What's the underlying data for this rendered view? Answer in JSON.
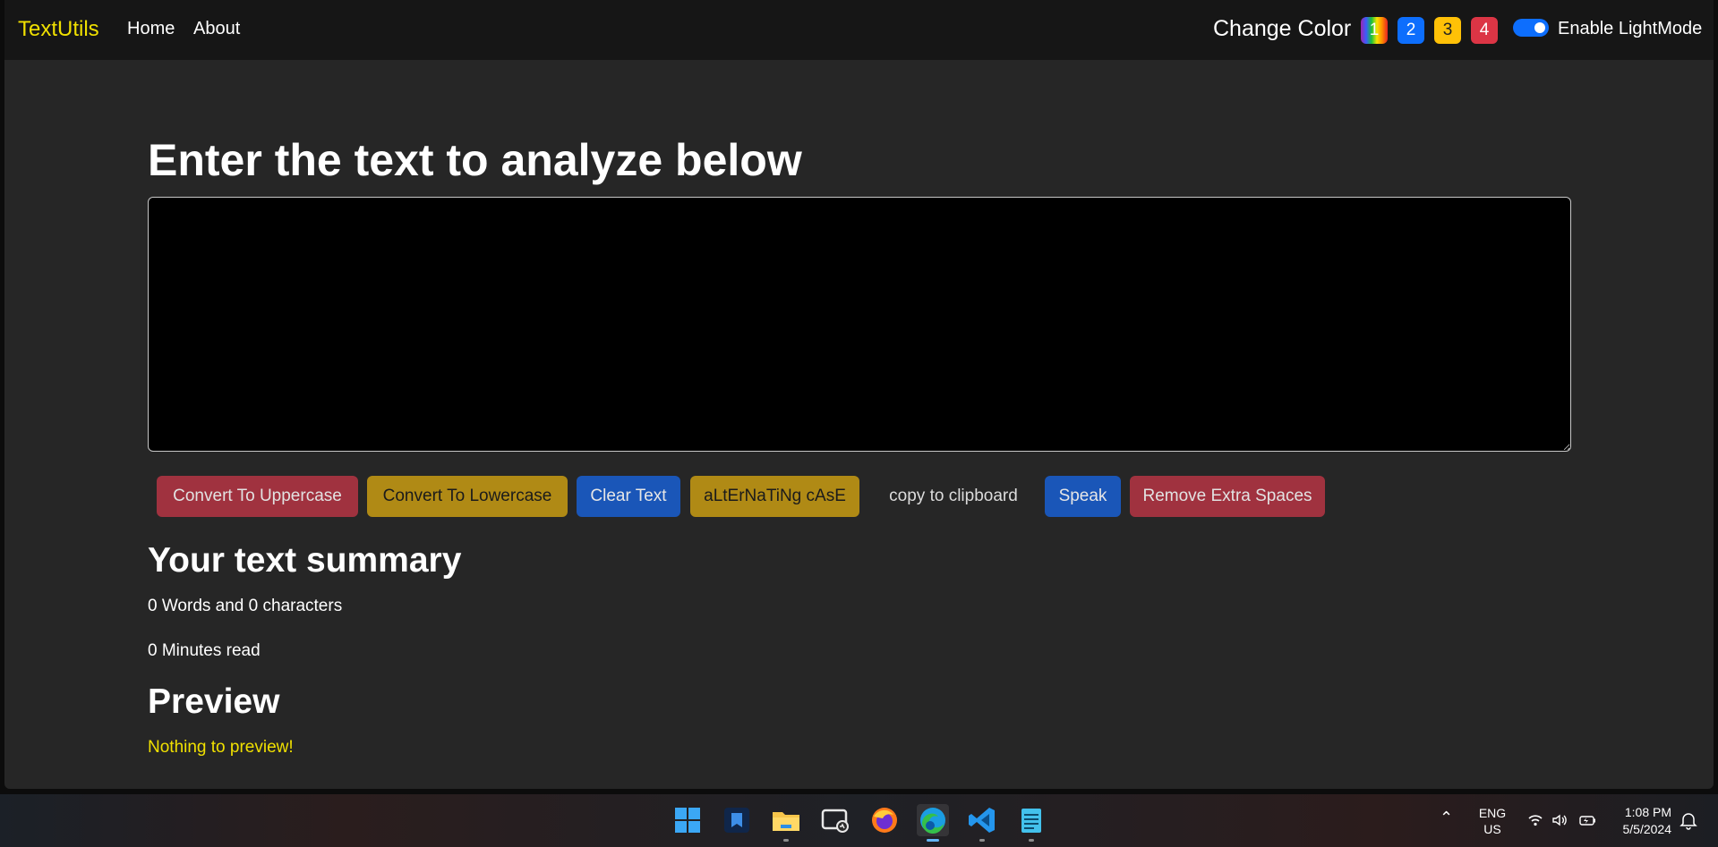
{
  "navbar": {
    "brand": "TextUtils",
    "links": [
      "Home",
      "About"
    ],
    "change_color_label": "Change Color",
    "swatches": [
      "1",
      "2",
      "3",
      "4"
    ],
    "swatch_colors": [
      "rainbow",
      "#0d6efd",
      "#ffc107",
      "#dc3545"
    ],
    "toggle_label": "Enable LightMode",
    "toggle_on": true,
    "brand_color": "#f0e000"
  },
  "main": {
    "heading": "Enter the text to analyze below",
    "textarea_value": "",
    "buttons": [
      "Convert To Uppercase",
      "Convert To Lowercase",
      "Clear Text",
      "aLtErNaTiNg cAsE",
      "copy to clipboard",
      "Speak",
      "Remove Extra Spaces"
    ],
    "summary_title": "Your text summary",
    "summary_words": "0 Words and 0 characters",
    "summary_read": "0 Minutes read",
    "preview_title": "Preview",
    "preview_text": "Nothing to preview!"
  },
  "taskbar": {
    "icons": [
      "windows-start-icon",
      "app-icon",
      "file-explorer-icon",
      "remote-desktop-icon",
      "firefox-icon",
      "edge-icon",
      "vscode-icon",
      "notepad-icon"
    ],
    "lang_line1": "ENG",
    "lang_line2": "US",
    "time": "1:08 PM",
    "date": "5/5/2024"
  }
}
